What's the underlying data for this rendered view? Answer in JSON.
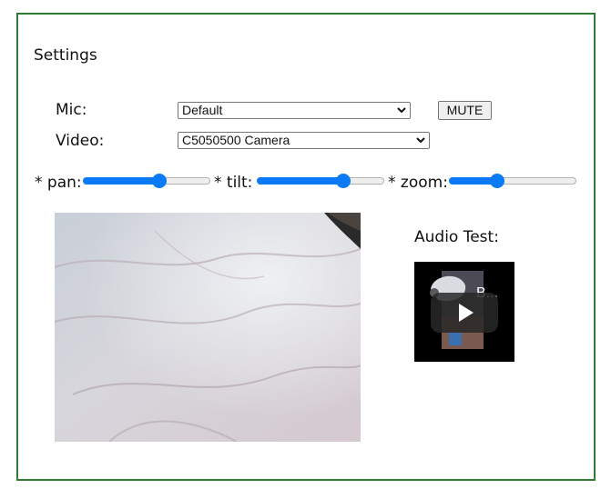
{
  "settings": {
    "title": "Settings"
  },
  "mic": {
    "label": "Mic:",
    "selected": "Default",
    "mute_label": "MUTE"
  },
  "video": {
    "label": "Video:",
    "selected": "C5050500 Camera"
  },
  "controls": {
    "pan": {
      "label": "* pan:",
      "value_fraction": 0.6
    },
    "tilt": {
      "label": "* tilt:",
      "value_fraction": 0.68
    },
    "zoom": {
      "label": "* zoom:",
      "value_fraction": 0.38
    }
  },
  "preview": {
    "camera_feed": "live-camera-preview",
    "audio_test_label": "Audio Test:",
    "audio_video_title_partial": "B..."
  },
  "colors": {
    "frame_border": "#2e7d32",
    "slider_accent": "#0a7af7"
  },
  "icons": {
    "select_chevron": "chevron-down-icon",
    "play": "play-icon"
  }
}
